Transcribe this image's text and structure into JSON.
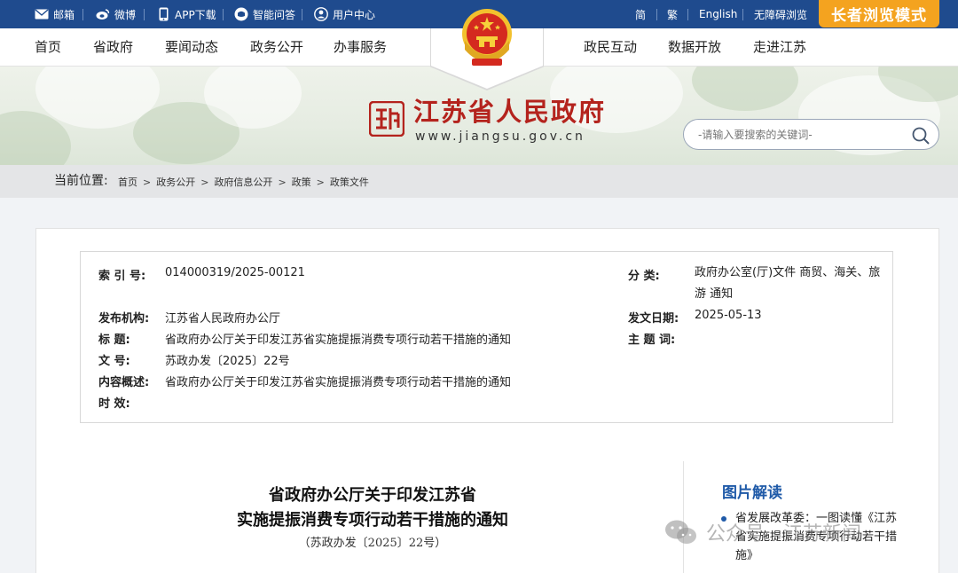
{
  "topbar": {
    "utils": [
      {
        "label": "邮箱",
        "icon": "mail-icon"
      },
      {
        "label": "微博",
        "icon": "weibo-icon"
      },
      {
        "label": "APP下载",
        "icon": "phone-icon"
      },
      {
        "label": "智能问答",
        "icon": "chat-icon"
      },
      {
        "label": "用户中心",
        "icon": "user-icon"
      }
    ],
    "lang": [
      "简",
      "繁",
      "English",
      "无障碍浏览"
    ],
    "elder_mode": "长者浏览模式"
  },
  "nav": {
    "left": [
      "首页",
      "省政府",
      "要闻动态",
      "政务公开",
      "办事服务"
    ],
    "right": [
      "政民互动",
      "数据开放",
      "走进江苏"
    ]
  },
  "banner": {
    "site_name": "江苏省人民政府",
    "site_url": "www.jiangsu.gov.cn",
    "search_placeholder": "-请输入要搜索的关键词-"
  },
  "breadcrumb": {
    "label": "当前位置:",
    "items": [
      "首页",
      "政务公开",
      "政府信息公开",
      "政策",
      "政策文件"
    ]
  },
  "meta": {
    "index_label": "索 引 号:",
    "index_value": "014000319/2025-00121",
    "category_label": "分 类:",
    "category_value": "政府办公室(厅)文件 商贸、海关、旅游 通知",
    "issuer_label": "发布机构:",
    "issuer_value": "江苏省人民政府办公厅",
    "date_label": "发文日期:",
    "date_value": "2025-05-13",
    "title_label": "标 题:",
    "title_value": "省政府办公厅关于印发江苏省实施提振消费专项行动若干措施的通知",
    "subject_label": "主 题 词:",
    "subject_value": "",
    "docno_label": "文 号:",
    "docno_value": "苏政办发〔2025〕22号",
    "summary_label": "内容概述:",
    "summary_value": "省政府办公厅关于印发江苏省实施提振消费专项行动若干措施的通知",
    "validity_label": "时 效:",
    "validity_value": ""
  },
  "document": {
    "title_line1": "省政府办公厅关于印发江苏省",
    "title_line2": "实施提振消费专项行动若干措施的通知",
    "number": "（苏政办发〔2025〕22号）"
  },
  "sidebar": {
    "title": "图片解读",
    "items": [
      "省发展改革委：一图读懂《江苏省实施提振消费专项行动若干措施》"
    ]
  },
  "watermark": {
    "text": "公众号 · 江苏新闻"
  },
  "colors": {
    "topbar": "#1f4b8e",
    "elder_button": "#f4a31f",
    "site_name": "#b4231d",
    "sidebar_title": "#1f5aa8"
  }
}
